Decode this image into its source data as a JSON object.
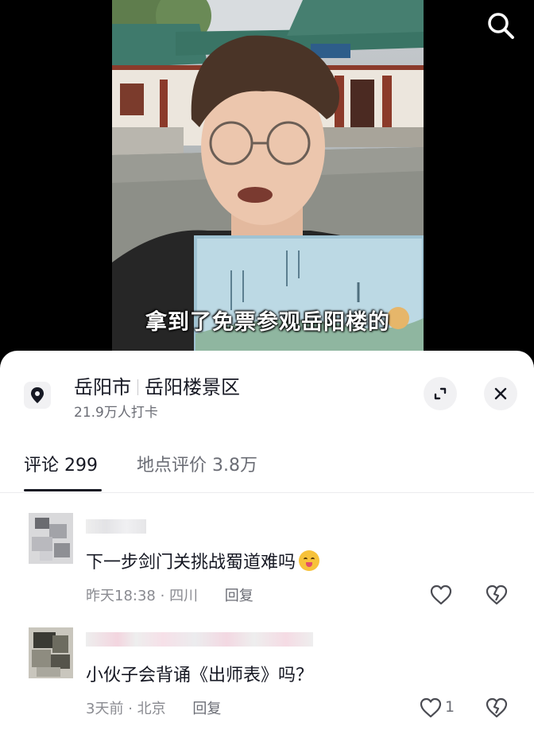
{
  "video": {
    "subtitle": "拿到了免票参观岳阳楼的",
    "search_icon": "search-icon"
  },
  "location": {
    "city": "岳阳市",
    "place": "岳阳楼景区",
    "checkins": "21.9万人打卡",
    "icon": "location-pin-icon",
    "expand_icon": "expand-icon",
    "close_icon": "close-icon"
  },
  "tabs": [
    {
      "label": "评论 299",
      "active": true
    },
    {
      "label": "地点评价 3.8万",
      "active": false
    }
  ],
  "comments": [
    {
      "text": "下一步剑门关挑战蜀道难吗",
      "emoji": "grinning-face-with-tongue-emoji",
      "time": "昨天18:38",
      "region": "四川",
      "reply_label": "回复",
      "likes": ""
    },
    {
      "text": "小伙子会背诵《出师表》吗？",
      "time": "3天前",
      "region": "北京",
      "reply_label": "回复",
      "likes": "1"
    }
  ],
  "colors": {
    "text_primary": "#161823",
    "text_secondary": "#6b6d75",
    "sheet_bg": "#ffffff",
    "video_bg": "#000000"
  }
}
